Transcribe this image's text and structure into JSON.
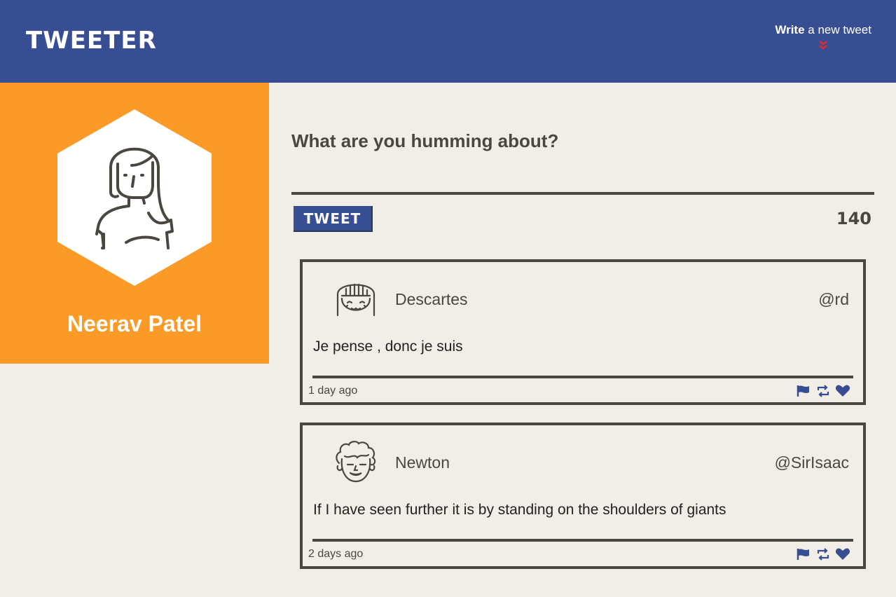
{
  "header": {
    "brand": "Tweeter",
    "compose_bold": "Write",
    "compose_rest": " a new tweet",
    "chevron_color": "#e0282f"
  },
  "profile": {
    "name": "Neerav Patel"
  },
  "composer": {
    "label": "What are you humming about?",
    "placeholder": "",
    "button_label": "Tweet",
    "counter": "140"
  },
  "tweets": [
    {
      "author": "Descartes",
      "handle": "@rd",
      "content": "Je pense , donc je suis",
      "age": "1 day ago",
      "icons": [
        "flag-icon",
        "retweet-icon",
        "heart-icon"
      ]
    },
    {
      "author": "Newton",
      "handle": "@SirIsaac",
      "content": "If I have seen further it is by standing on the shoulders of giants",
      "age": "2 days ago",
      "icons": [
        "flag-icon",
        "retweet-icon",
        "heart-icon"
      ]
    }
  ],
  "colors": {
    "navbar": "#384e93",
    "profile_bg": "#fb9a26",
    "page_bg": "#f1eee8",
    "text": "#4a4640"
  }
}
